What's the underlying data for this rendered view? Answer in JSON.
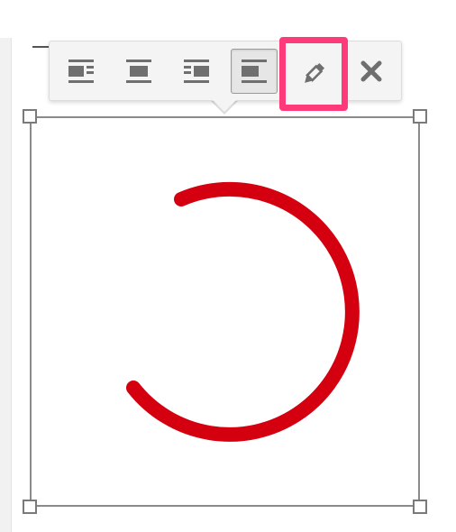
{
  "editor": {
    "toolbar": {
      "buttons": [
        {
          "id": "align-left",
          "icon": "align-left-icon",
          "active": false
        },
        {
          "id": "align-center",
          "icon": "align-center-icon",
          "active": false
        },
        {
          "id": "align-right",
          "icon": "align-right-icon",
          "active": false
        },
        {
          "id": "align-none",
          "icon": "align-none-icon",
          "active": true
        },
        {
          "id": "edit",
          "icon": "pencil-icon",
          "active": false,
          "highlighted": true
        },
        {
          "id": "remove",
          "icon": "close-icon",
          "active": false
        }
      ]
    },
    "image": {
      "subject": "red-circular-arc",
      "stroke_color": "#d40010"
    },
    "colors": {
      "highlight": "#ff3a7a",
      "toolbar_bg": "#f4f4f4",
      "icon": "#6f6f6f"
    }
  }
}
